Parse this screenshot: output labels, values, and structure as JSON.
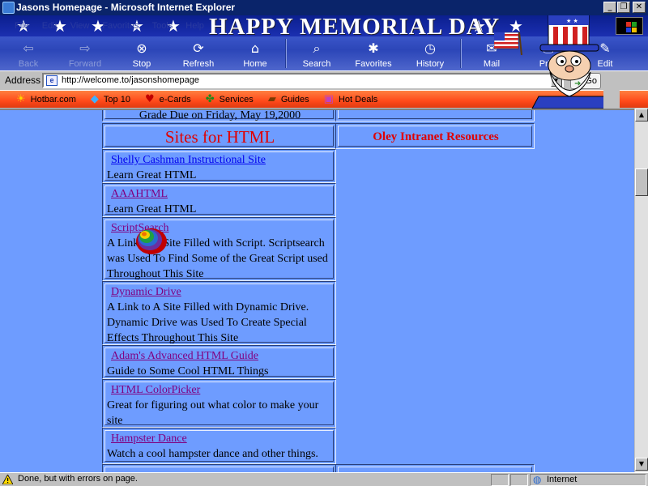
{
  "window": {
    "title": "Jasons Homepage - Microsoft Internet Explorer",
    "minimize": "_",
    "restore": "❐",
    "close": "✕"
  },
  "banner": {
    "title": "HAPPY MEMORIAL DAY"
  },
  "menu": [
    "File",
    "Edit",
    "View",
    "Favorites",
    "Tools",
    "Help"
  ],
  "toolbar": [
    {
      "label": "Back",
      "icon": "back-arrow-icon",
      "glyph": "⇦",
      "enabled": false
    },
    {
      "label": "Forward",
      "icon": "forward-arrow-icon",
      "glyph": "⇨",
      "enabled": false
    },
    {
      "label": "Stop",
      "icon": "stop-icon",
      "glyph": "⊗",
      "enabled": true
    },
    {
      "label": "Refresh",
      "icon": "refresh-icon",
      "glyph": "⟳",
      "enabled": true
    },
    {
      "label": "Home",
      "icon": "home-icon",
      "glyph": "⌂",
      "enabled": true
    },
    {
      "label": "Search",
      "icon": "search-icon",
      "glyph": "⌕",
      "enabled": true
    },
    {
      "label": "Favorites",
      "icon": "favorites-icon",
      "glyph": "✱",
      "enabled": true
    },
    {
      "label": "History",
      "icon": "history-icon",
      "glyph": "◷",
      "enabled": true
    },
    {
      "label": "Mail",
      "icon": "mail-icon",
      "glyph": "✉",
      "enabled": true
    },
    {
      "label": "Print",
      "icon": "print-icon",
      "glyph": "⎙",
      "enabled": true
    },
    {
      "label": "Edit",
      "icon": "edit-icon",
      "glyph": "✎",
      "enabled": true
    }
  ],
  "address": {
    "label": "Address",
    "url": "http://welcome.to/jasonshomepage",
    "go_label": "Go"
  },
  "links_bar": [
    {
      "label": "Hotbar.com",
      "icon": "sun-icon",
      "glyph": "☀",
      "color": "#ffd700"
    },
    {
      "label": "Top 10",
      "icon": "diamond-icon",
      "glyph": "◆",
      "color": "#40b0ff"
    },
    {
      "label": "e-Cards",
      "icon": "heart-icon",
      "glyph": "♥",
      "color": "#c00000"
    },
    {
      "label": "Services",
      "icon": "clover-icon",
      "glyph": "✤",
      "color": "#1a8a1a"
    },
    {
      "label": "Guides",
      "icon": "book-icon",
      "glyph": "▰",
      "color": "#7a3a00"
    },
    {
      "label": "Hot Deals",
      "icon": "gift-icon",
      "glyph": "▣",
      "color": "#c040c0"
    }
  ],
  "page": {
    "grade_text": "Grade Due on Friday, May 19,2000",
    "sites_heading": "Sites for HTML",
    "oley_heading": "Oley Intranet Resources",
    "sites": [
      {
        "name": "Shelly Cashman Instructional Site",
        "desc": "Learn Great HTML",
        "visited": false
      },
      {
        "name": "AAAHTML",
        "desc": "Learn Great HTML",
        "visited": true
      },
      {
        "name": "ScriptSearch",
        "desc": "A Link to A Site Filled with Script. Scriptsearch was Used To Find Some of the Great Script used Throughout This Site",
        "visited": true
      },
      {
        "name": "Dynamic Drive",
        "desc": "A Link to A Site Filled with Dynamic Drive. Dynamic Drive was Used To Create Special Effects Throughout This Site",
        "visited": true
      },
      {
        "name": "Adam's Advanced HTML Guide",
        "desc": "Guide to Some Cool HTML Things",
        "visited": true
      },
      {
        "name": "HTML ColorPicker",
        "desc": "Great for figuring out what color to make your site",
        "visited": true
      },
      {
        "name": "Hampster Dance",
        "desc": "Watch a cool hampster dance and other things.",
        "visited": true
      }
    ]
  },
  "status": {
    "text": "Done, but with errors on page.",
    "zone": "Internet"
  },
  "colors": {
    "title_bar": "#0a246a",
    "page_background": "#6e9cff",
    "heading_red": "#e00000",
    "link_blue": "#0000ee",
    "link_visited": "#800080"
  }
}
